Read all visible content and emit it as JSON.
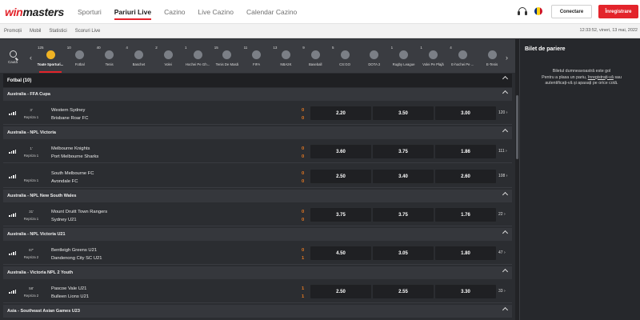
{
  "header": {
    "logo_win": "win",
    "logo_masters": "masters",
    "nav": [
      "Sporturi",
      "Pariuri Live",
      "Cazino",
      "Live Cazino",
      "Calendar Cazino"
    ],
    "active_nav": "Pariuri Live",
    "login_label": "Conectare",
    "register_label": "Înregistrare",
    "accent_color": "#e3242b"
  },
  "subnav": {
    "links": [
      "Promoții",
      "Mobil",
      "Statistici",
      "Scoruri Live"
    ],
    "datetime": "12:33:52, vineri, 13 mai, 2022"
  },
  "sports_bar": {
    "search_label": "Caută",
    "sports": [
      {
        "count": "125",
        "label": "Toate Sporturi...",
        "active": true
      },
      {
        "count": "10",
        "label": "Fotbal"
      },
      {
        "count": "40",
        "label": "Tenis"
      },
      {
        "count": "4",
        "label": "Baschet"
      },
      {
        "count": "2",
        "label": "Volei"
      },
      {
        "count": "1",
        "label": "Hochei Pe Gh..."
      },
      {
        "count": "15",
        "label": "Tenis De Masă"
      },
      {
        "count": "11",
        "label": "FIFA"
      },
      {
        "count": "13",
        "label": "NBA2K"
      },
      {
        "count": "9",
        "label": "Baseball"
      },
      {
        "count": "5",
        "label": "CS:GO"
      },
      {
        "count": "",
        "label": "DOTA 2"
      },
      {
        "count": "1",
        "label": "Rugby League"
      },
      {
        "count": "1",
        "label": "Volei Pe Plajă"
      },
      {
        "count": "4",
        "label": "E-hochei Pe ..."
      },
      {
        "count": "",
        "label": "E-Tenis"
      }
    ]
  },
  "events": {
    "sport_title": "Fotbal (10)",
    "leagues": [
      {
        "name": "Australia - FFA Cupa",
        "matches": [
          {
            "minute": "3'",
            "period": "Repriza 1",
            "home": "Western Sydney",
            "away": "Brisbane Roar FC",
            "score_home": "0",
            "score_away": "0",
            "odds": [
              "2.20",
              "3.50",
              "3.00"
            ],
            "more": "120"
          }
        ]
      },
      {
        "name": "Australia - NPL Victoria",
        "matches": [
          {
            "minute": "1'",
            "period": "Repriza 1",
            "home": "Melbourne Knights",
            "away": "Port Melbourne Sharks",
            "score_home": "0",
            "score_away": "0",
            "odds": [
              "3.60",
              "3.75",
              "1.86"
            ],
            "more": "111"
          },
          {
            "minute": "",
            "period": "Repriza 1",
            "home": "South Melbourne FC",
            "away": "Avondale FC",
            "score_home": "0",
            "score_away": "0",
            "odds": [
              "2.50",
              "3.40",
              "2.60"
            ],
            "more": "108"
          }
        ]
      },
      {
        "name": "Australia - NPL New South Wales",
        "matches": [
          {
            "minute": "31'",
            "period": "Repriza 1",
            "home": "Mount Druitt Town Rangers",
            "away": "Sydney U21",
            "score_home": "0",
            "score_away": "0",
            "odds": [
              "3.75",
              "3.75",
              "1.76"
            ],
            "more": "22"
          }
        ]
      },
      {
        "name": "Australia - NPL Victoria U21",
        "matches": [
          {
            "minute": "67'",
            "period": "Repriza 2",
            "home": "Bentleigh Greens U21",
            "away": "Dandenong City SC U21",
            "score_home": "0",
            "score_away": "1",
            "odds": [
              "4.50",
              "3.05",
              "1.80"
            ],
            "more": "47"
          }
        ]
      },
      {
        "name": "Australia - Victoria NPL 2 Youth",
        "matches": [
          {
            "minute": "58'",
            "period": "Repriza 2",
            "home": "Pascoe Vale U21",
            "away": "Bulleen Lions U21",
            "score_home": "1",
            "score_away": "1",
            "odds": [
              "2.50",
              "2.55",
              "3.30"
            ],
            "more": "33"
          }
        ]
      },
      {
        "name": "Asia - Southeast Asian Games U23",
        "matches": []
      }
    ]
  },
  "betslip": {
    "title": "Bilet de pariere",
    "line1": "Biletul dumneavoastră este gol",
    "line2_pre": "Pentru a plasa un pariu, ",
    "line2_link": "înregistrați-vă",
    "line2_post": " sau",
    "line3": "autentificați-vă și apasați pe orice cotă."
  }
}
